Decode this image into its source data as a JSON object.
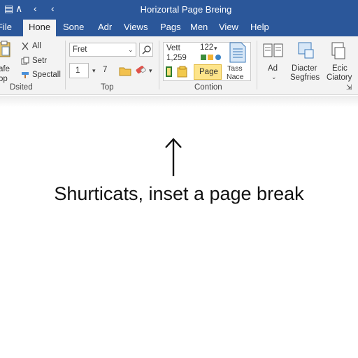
{
  "window": {
    "title": "Horizortal Page Breing"
  },
  "tabs": [
    {
      "label": "File",
      "active": false
    },
    {
      "label": "Hone",
      "active": true
    },
    {
      "label": "Sone",
      "active": false
    },
    {
      "label": "Adr",
      "active": false
    },
    {
      "label": "Views",
      "active": false
    },
    {
      "label": "Pags",
      "active": false
    },
    {
      "label": "Men",
      "active": false
    },
    {
      "label": "View",
      "active": false
    },
    {
      "label": "Help",
      "active": false
    }
  ],
  "ribbon": {
    "clipboard": {
      "items": [
        "All",
        "Setr",
        "Spectall"
      ],
      "left_labels": [
        "afe",
        "op"
      ],
      "group_label": "Dsited"
    },
    "font": {
      "font_name": "Fret",
      "font_size": "1",
      "size_step": "7",
      "group_label": "Top"
    },
    "position": {
      "text_lines": [
        "Vett",
        "1,259",
        "122"
      ],
      "highlight_label": "Page",
      "side_label_lines": [
        "Tass",
        "Nace"
      ],
      "group_label": "Contion"
    },
    "right": {
      "buttons": [
        {
          "label": "Ad",
          "has_dropdown": true
        },
        {
          "label_lines": [
            "Diacter",
            "Segfries"
          ]
        },
        {
          "label_lines": [
            "Ecic",
            "Ciatory"
          ]
        }
      ]
    }
  },
  "document": {
    "caption": "Shurticats, inset a page break"
  },
  "colors": {
    "title_bar": "#2b579a",
    "ribbon_bg": "#f3f3f3",
    "highlight": "#fde48a"
  }
}
